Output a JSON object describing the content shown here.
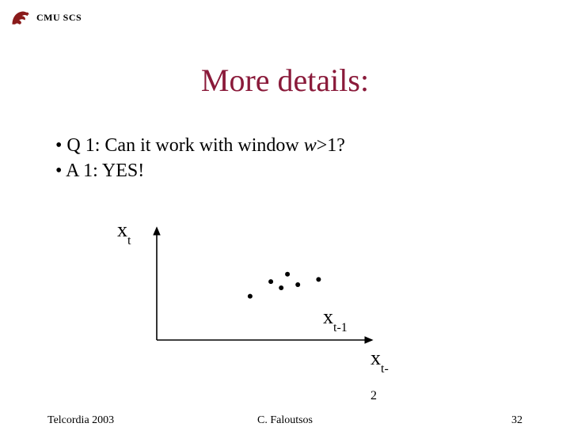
{
  "header": {
    "org": "CMU SCS"
  },
  "title": "More details:",
  "bullets": [
    {
      "prefix": "• Q 1: Can it work with window ",
      "var": "w",
      "suffix": ">1?"
    },
    {
      "prefix": "• A 1: YES!",
      "var": "",
      "suffix": ""
    }
  ],
  "axis_labels": {
    "y_var": "x",
    "y_sub": "t",
    "x1_var": "x",
    "x1_sub": "t-1",
    "x2_var": "x",
    "x2_sub": "t-2"
  },
  "chart_data": {
    "type": "scatter",
    "title": "",
    "xlabel": "x_{t-1}",
    "ylabel": "x_t",
    "annotations": [
      "x_{t-2}"
    ],
    "xlim": [
      0,
      10
    ],
    "ylim": [
      0,
      10
    ],
    "series": [
      {
        "name": "points",
        "x": [
          4.5,
          5.5,
          6.0,
          6.3,
          6.8,
          7.8
        ],
        "y": [
          4.2,
          5.6,
          5.0,
          6.3,
          5.3,
          5.8
        ]
      }
    ]
  },
  "footer": {
    "left": "Telcordia 2003",
    "center": "C. Faloutsos",
    "right": "32"
  }
}
